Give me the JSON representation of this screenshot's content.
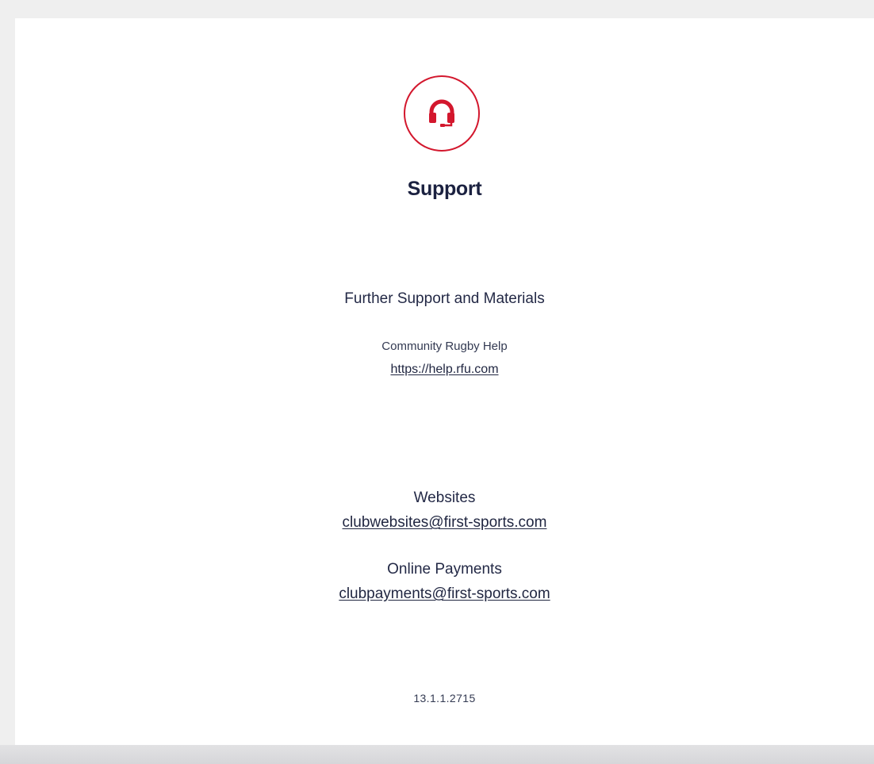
{
  "header": {
    "icon": "headset-icon",
    "title": "Support"
  },
  "further_support": {
    "heading": "Further Support and Materials",
    "community_label": "Community Rugby Help",
    "community_link": "https://help.rfu.com"
  },
  "contacts": {
    "websites_label": "Websites",
    "websites_email": "clubwebsites@first-sports.com",
    "payments_label": "Online Payments",
    "payments_email": "clubpayments@first-sports.com"
  },
  "version": "13.1.1.2715",
  "colors": {
    "accent": "#d3172d",
    "text": "#1f2540",
    "background": "#efefef",
    "card": "#ffffff"
  }
}
